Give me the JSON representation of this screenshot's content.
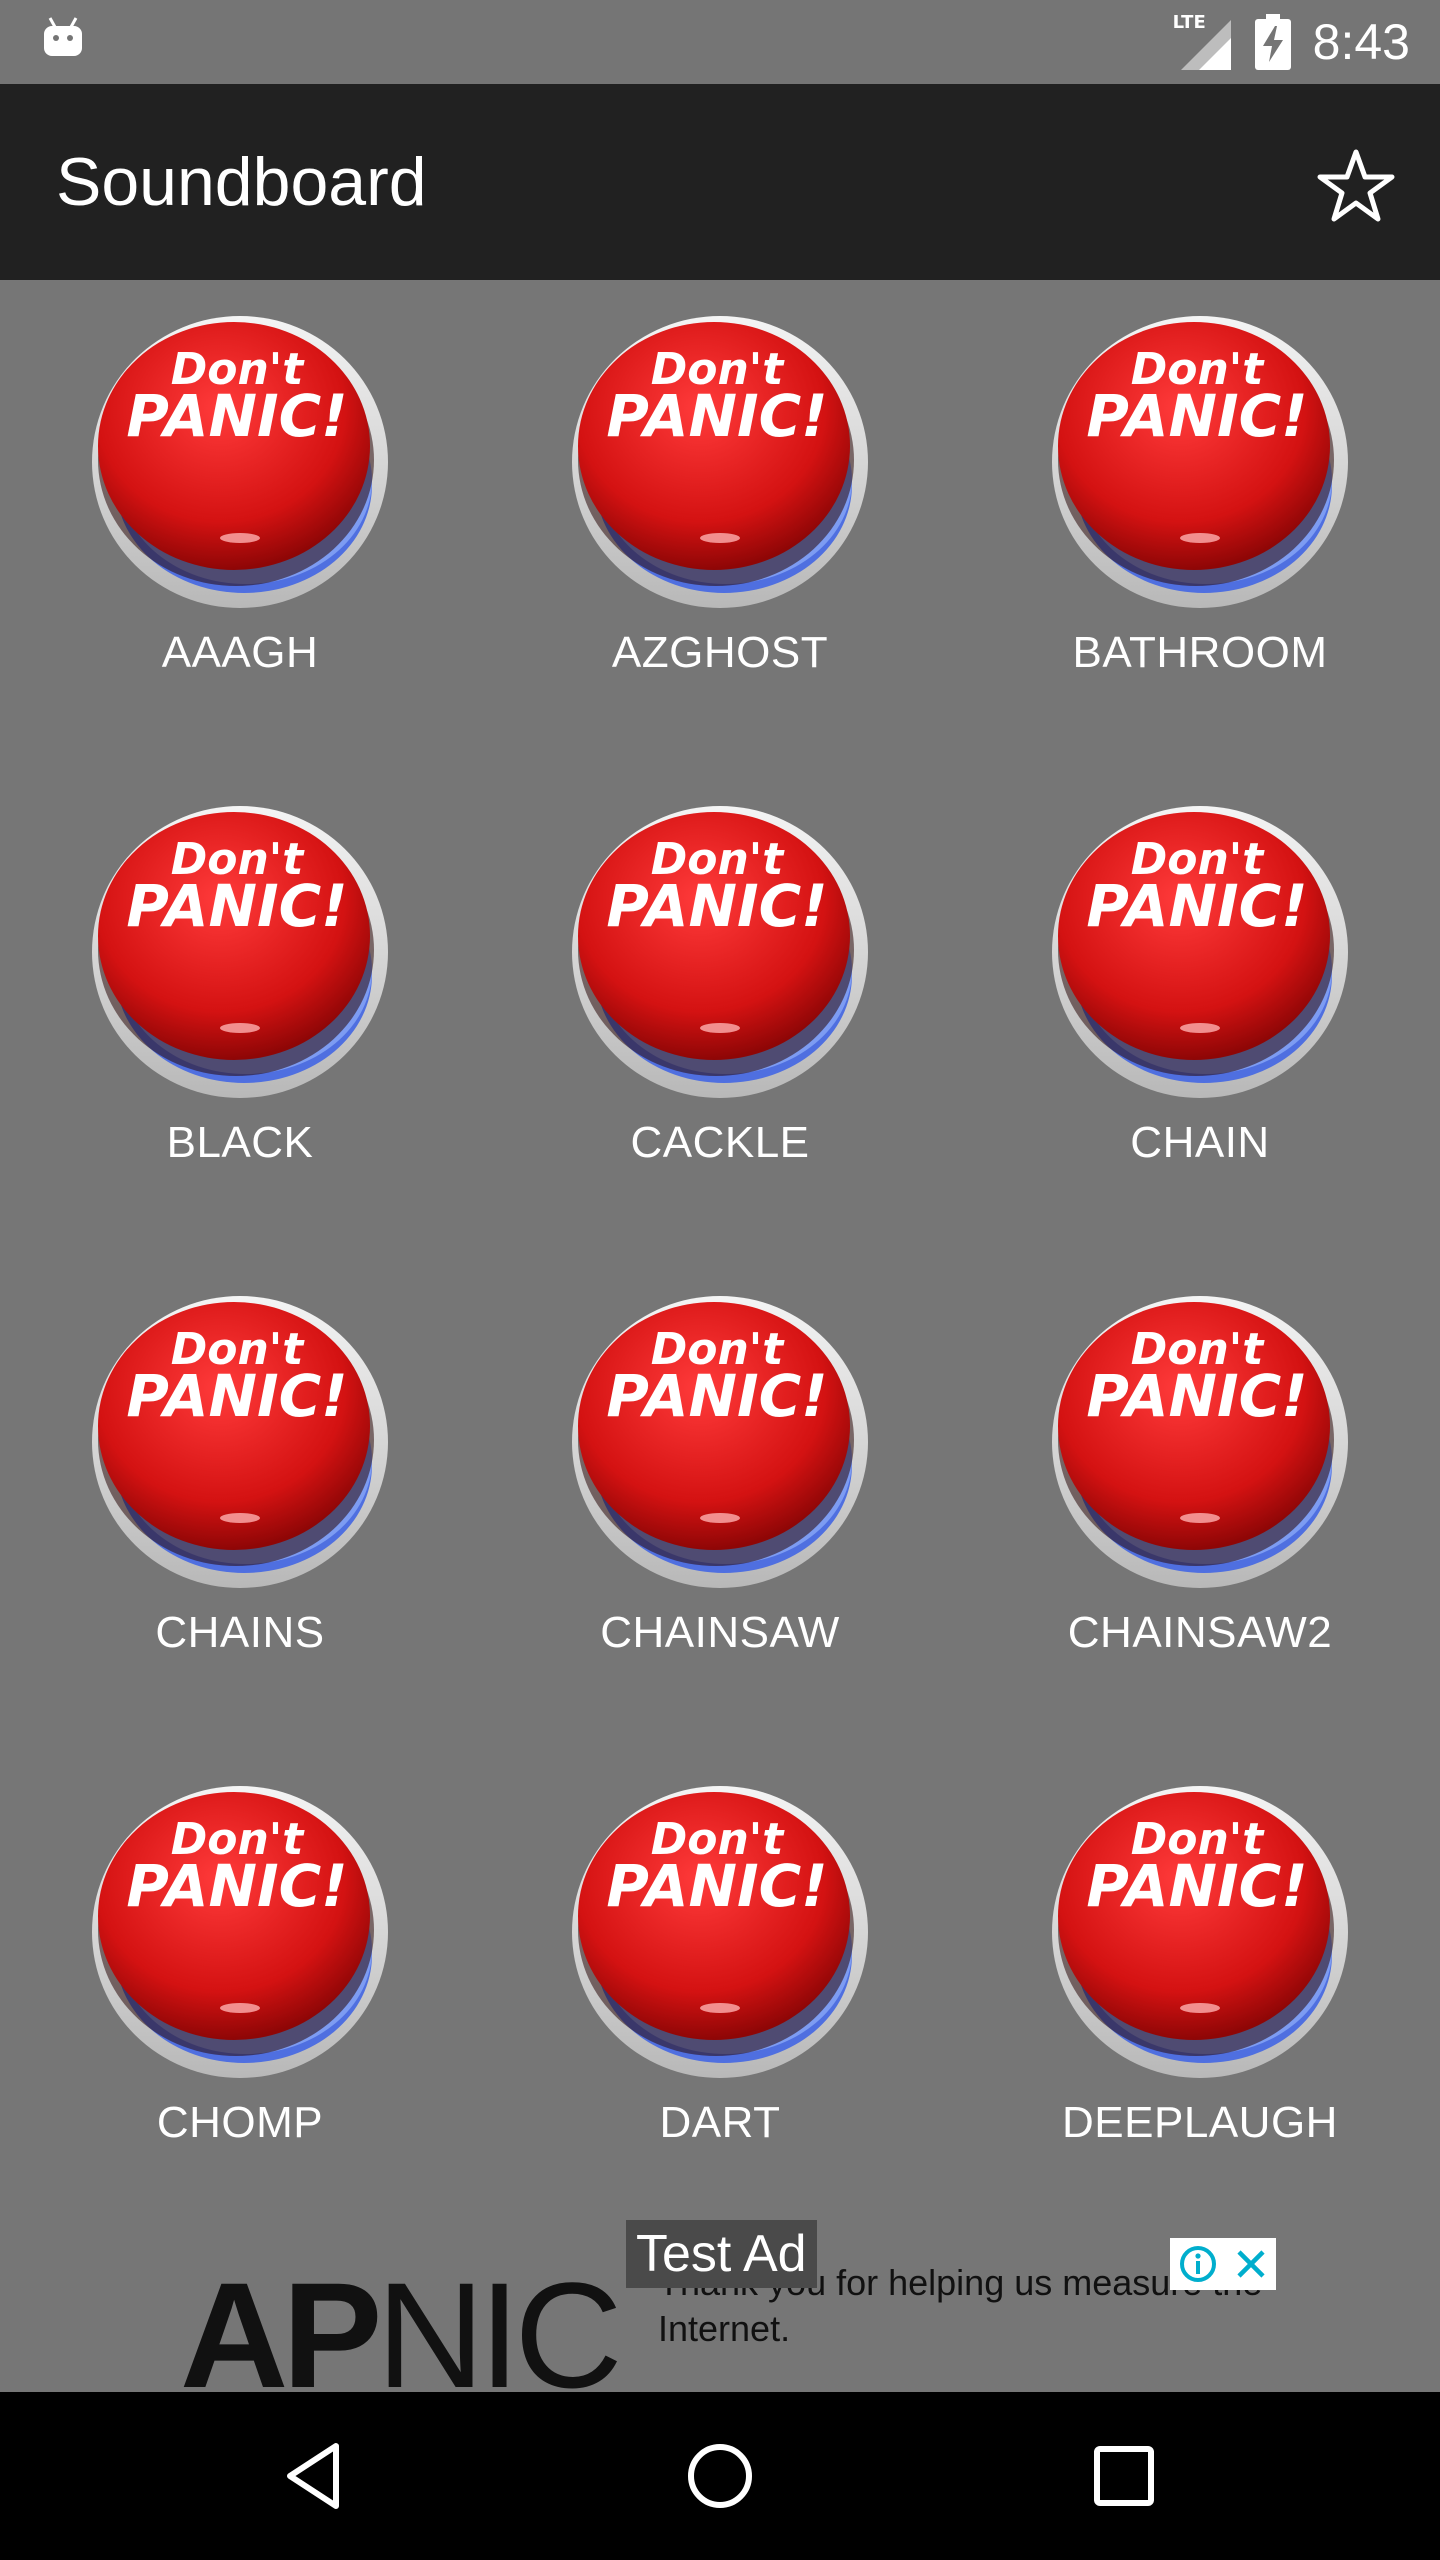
{
  "status_bar": {
    "network": "LTE",
    "time": "8:43",
    "icons": [
      "android-icon",
      "signal-icon",
      "battery-charging-icon"
    ]
  },
  "app_bar": {
    "title": "Soundboard",
    "action_icon": "star-outline-icon"
  },
  "sound_button_art": {
    "line1": "Don't",
    "line2": "PANIC!"
  },
  "sounds": [
    {
      "label": "AAAGH"
    },
    {
      "label": "AZGHOST"
    },
    {
      "label": "BATHROOM"
    },
    {
      "label": "BLACK"
    },
    {
      "label": "CACKLE"
    },
    {
      "label": "CHAIN"
    },
    {
      "label": "CHAINS"
    },
    {
      "label": "CHAINSAW"
    },
    {
      "label": "CHAINSAW2"
    },
    {
      "label": "CHOMP"
    },
    {
      "label": "DART"
    },
    {
      "label": "DEEPLAUGH"
    }
  ],
  "ad": {
    "badge": "Test Ad",
    "logo_bold": "AP",
    "logo_rest": "NIC",
    "text": "Thank you for helping us measure the Internet.",
    "choices_icons": [
      "info-icon",
      "close-icon"
    ]
  },
  "nav_bar": {
    "buttons": [
      "back-icon",
      "home-icon",
      "recents-icon"
    ]
  },
  "colors": {
    "background": "#767676",
    "app_bar": "#212121",
    "status_bar": "#757575",
    "nav_bar": "#000000",
    "button_red": "#d81818"
  }
}
